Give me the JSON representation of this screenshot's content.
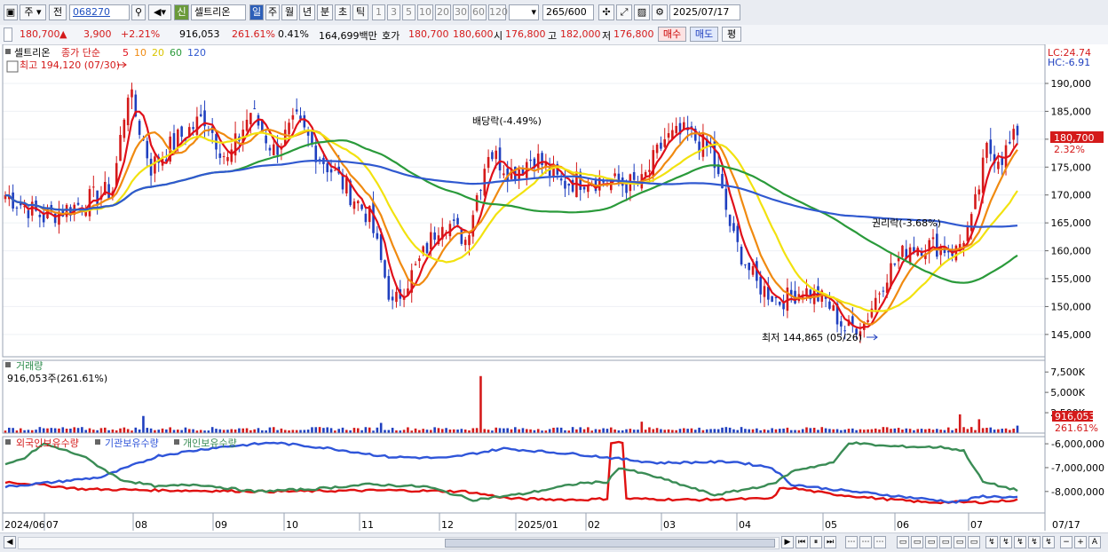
{
  "toolbar": {
    "type_label": "주",
    "all_label": "전",
    "code": "068270",
    "shin_label": "신",
    "stock_name": "셀트리온",
    "periods": [
      "일",
      "주",
      "월",
      "년",
      "분",
      "초",
      "틱"
    ],
    "active_period": "일",
    "counts": [
      "1",
      "3",
      "5",
      "10",
      "20",
      "30",
      "60",
      "120"
    ],
    "view_count": "265",
    "total_count": "/600",
    "date": "2025/07/17"
  },
  "info": {
    "price": "180,700",
    "arrow": "▲",
    "change": "3,900",
    "change_pct": "+2.21%",
    "volume": "916,053",
    "volume_ratio": "261.61%",
    "turnover": "0.41%",
    "amount": "164,699백만",
    "hoga_label": "호가",
    "ask": "180,700",
    "bid": "180,600",
    "open_label": "시",
    "open": "176,800",
    "high_label": "고",
    "high": "182,000",
    "low_label": "저",
    "low": "176,800",
    "buy_label": "매수",
    "sell_label": "매도",
    "avg_label": "평"
  },
  "legend": {
    "name": "셀트리온",
    "ma_prefix": "종가 단순",
    "ma5": "5",
    "ma10": "10",
    "ma20": "20",
    "ma60": "60",
    "ma120": "120",
    "lc": "LC:24.74",
    "hc": "HC:-6.91"
  },
  "volume_legend": {
    "title": "거래량",
    "value": "916,053주(261.61%)"
  },
  "holdings_legend": {
    "foreign": "외국인보유수량",
    "inst": "기관보유수량",
    "indiv": "개인보유수량"
  },
  "colors": {
    "up": "#d41a1a",
    "down": "#1f3fbf",
    "ma5": "#e0101a",
    "ma10": "#f08a10",
    "ma20": "#f2e20f",
    "ma60": "#2a9a3a",
    "ma120": "#3059d0",
    "foreign": "#e01010",
    "inst": "#2f55d9",
    "indiv": "#3a8c55"
  },
  "chart_data": [
    {
      "type": "candlestick",
      "title": "셀트리온",
      "ylim": [
        141000,
        197000
      ],
      "y_ticks": [
        "190,000",
        "185,000",
        "180,000",
        "175,000",
        "170,000",
        "165,000",
        "160,000",
        "155,000",
        "150,000",
        "145,000"
      ],
      "x_tick_labels": [
        "2024/06",
        "07",
        "08",
        "09",
        "10",
        "11",
        "12",
        "2025/01",
        "02",
        "03",
        "04",
        "05",
        "06",
        "07",
        "07/17"
      ],
      "bars": 265,
      "last_close": 180700,
      "last_label": "180,700",
      "last_pct": "2.32%",
      "annotations": {
        "high": "최고 194,120 (07/30)",
        "low": "최저 144,865 (05/26)",
        "dividend": "배당락(-4.49%)",
        "rights": "권리락(-3.68%)"
      },
      "anchors": [
        [
          0,
          170000
        ],
        [
          10,
          166000
        ],
        [
          18,
          168000
        ],
        [
          28,
          171000
        ],
        [
          32,
          189000
        ],
        [
          38,
          175000
        ],
        [
          45,
          180000
        ],
        [
          52,
          184000
        ],
        [
          58,
          176000
        ],
        [
          64,
          185000
        ],
        [
          70,
          178000
        ],
        [
          76,
          183000
        ],
        [
          82,
          177000
        ],
        [
          88,
          172000
        ],
        [
          95,
          166000
        ],
        [
          101,
          150000
        ],
        [
          108,
          158000
        ],
        [
          114,
          166000
        ],
        [
          120,
          162000
        ],
        [
          126,
          178000
        ],
        [
          132,
          174000
        ],
        [
          138,
          177000
        ],
        [
          145,
          172000
        ],
        [
          152,
          173000
        ],
        [
          160,
          172000
        ],
        [
          166,
          172000
        ],
        [
          172,
          180000
        ],
        [
          178,
          181000
        ],
        [
          184,
          178000
        ],
        [
          190,
          162000
        ],
        [
          196,
          154000
        ],
        [
          202,
          151000
        ],
        [
          208,
          153000
        ],
        [
          214,
          151000
        ],
        [
          219,
          146000
        ],
        [
          224,
          147000
        ],
        [
          230,
          156000
        ],
        [
          236,
          161000
        ],
        [
          242,
          161000
        ],
        [
          248,
          160000
        ],
        [
          252,
          165000
        ],
        [
          256,
          178000
        ],
        [
          260,
          177000
        ],
        [
          264,
          180700
        ]
      ],
      "series": [
        {
          "name": "5",
          "kind": "sma"
        },
        {
          "name": "10",
          "kind": "sma"
        },
        {
          "name": "20",
          "kind": "sma"
        },
        {
          "name": "60",
          "kind": "sma"
        },
        {
          "name": "120",
          "kind": "sma"
        }
      ]
    },
    {
      "type": "bar",
      "title": "거래량",
      "ylim": [
        0,
        8500
      ],
      "y_ticks": [
        "7,500K",
        "5,000K",
        "2,500K"
      ],
      "last_value": "916,053",
      "last_pct": "261.61%",
      "spikes": [
        [
          36,
          2100
        ],
        [
          98,
          1250
        ],
        [
          124,
          7000
        ],
        [
          166,
          1400
        ],
        [
          249,
          2300
        ],
        [
          254,
          1700
        ],
        [
          264,
          916
        ]
      ]
    },
    {
      "type": "line",
      "title": "보유수량",
      "ylim": [
        -8900000,
        -5700000
      ],
      "y_ticks": [
        "-6,000,000",
        "-7,000,000",
        "-8,000,000"
      ],
      "series": [
        {
          "name": "외국인보유수량",
          "anchors": [
            [
              0,
              -7600000
            ],
            [
              8,
              -7700000
            ],
            [
              20,
              -7900000
            ],
            [
              40,
              -7950000
            ],
            [
              70,
              -8000000
            ],
            [
              100,
              -7950000
            ],
            [
              120,
              -8000000
            ],
            [
              132,
              -8300000
            ],
            [
              150,
              -8350000
            ],
            [
              157,
              -8300000
            ],
            [
              158,
              -5950000
            ],
            [
              161,
              -5950000
            ],
            [
              162,
              -8300000
            ],
            [
              180,
              -8350000
            ],
            [
              200,
              -8300000
            ],
            [
              202,
              -7900000
            ],
            [
              205,
              -7850000
            ],
            [
              215,
              -8100000
            ],
            [
              228,
              -8300000
            ],
            [
              240,
              -8450000
            ],
            [
              255,
              -8450000
            ],
            [
              264,
              -8350000
            ]
          ]
        },
        {
          "name": "기관보유수량",
          "anchors": [
            [
              0,
              -7800000
            ],
            [
              10,
              -7650000
            ],
            [
              25,
              -7400000
            ],
            [
              40,
              -6500000
            ],
            [
              55,
              -6150000
            ],
            [
              70,
              -5950000
            ],
            [
              85,
              -6200000
            ],
            [
              100,
              -6550000
            ],
            [
              115,
              -6600000
            ],
            [
              130,
              -6200000
            ],
            [
              150,
              -6450000
            ],
            [
              170,
              -6800000
            ],
            [
              190,
              -6750000
            ],
            [
              200,
              -7000000
            ],
            [
              205,
              -7700000
            ],
            [
              215,
              -7900000
            ],
            [
              230,
              -8150000
            ],
            [
              248,
              -8450000
            ],
            [
              255,
              -8200000
            ],
            [
              264,
              -8250000
            ]
          ]
        },
        {
          "name": "개인보유수량",
          "anchors": [
            [
              0,
              -6900000
            ],
            [
              5,
              -6600000
            ],
            [
              10,
              -6000000
            ],
            [
              20,
              -6500000
            ],
            [
              30,
              -7500000
            ],
            [
              40,
              -7800000
            ],
            [
              50,
              -7700000
            ],
            [
              65,
              -8000000
            ],
            [
              80,
              -7900000
            ],
            [
              95,
              -7700000
            ],
            [
              110,
              -7800000
            ],
            [
              122,
              -8350000
            ],
            [
              135,
              -8100000
            ],
            [
              150,
              -7650000
            ],
            [
              157,
              -7600000
            ],
            [
              160,
              -7000000
            ],
            [
              170,
              -7400000
            ],
            [
              185,
              -8150000
            ],
            [
              200,
              -7700000
            ],
            [
              206,
              -7100000
            ],
            [
              216,
              -6800000
            ],
            [
              220,
              -5950000
            ],
            [
              230,
              -6100000
            ],
            [
              245,
              -6150000
            ],
            [
              250,
              -6300000
            ],
            [
              255,
              -7600000
            ],
            [
              264,
              -7950000
            ]
          ]
        }
      ]
    }
  ]
}
